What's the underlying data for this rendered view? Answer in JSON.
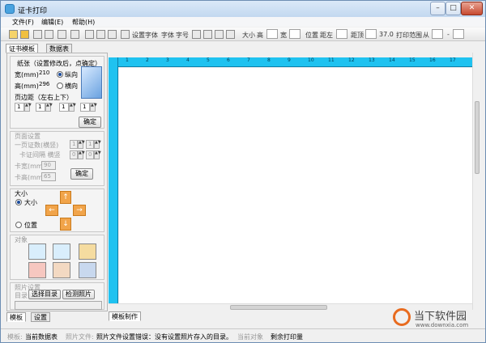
{
  "window": {
    "title": "证卡打印"
  },
  "menu": [
    "文件(F)",
    "编辑(E)",
    "帮助(H)"
  ],
  "toolbar": {
    "icons": [
      "new-icon",
      "open-icon",
      "save-icon",
      "save-as-icon",
      "print-icon",
      "preview-icon",
      "copy-icon",
      "paste-icon",
      "cut-icon",
      "text-icon"
    ],
    "labels": [
      "设置字体",
      "字体",
      "字号",
      "大小",
      "高",
      "宽",
      "位置",
      "距左",
      "距顶",
      "37.0",
      "打印范围",
      "从",
      "-"
    ]
  },
  "left_tabs": [
    "证书模板",
    "数据表"
  ],
  "paper": {
    "title": "纸张（设置修改后，点确定）",
    "width_label": "宽(mm)",
    "width_value": "210",
    "height_label": "高(mm)",
    "height_value": "296",
    "portrait": "纵向",
    "landscape": "横向",
    "margin_title": "页边距（左右上下）",
    "margins": [
      "1",
      "1",
      "1",
      "1"
    ],
    "ok": "确定"
  },
  "page_setup": {
    "title": "页面设置",
    "per_page": "一页证数(横竖)",
    "gap": "卡证间隔 横竖",
    "card_width_label": "卡宽(mm)",
    "card_width_value": "90",
    "card_height_label": "卡高(mm)",
    "card_height_value": "65",
    "spin_values": [
      "1",
      "1",
      "0",
      "0"
    ],
    "ok": "确定"
  },
  "size_group": {
    "title": "大小",
    "size_option": "大小",
    "position_option": "位置"
  },
  "objects": {
    "title": "对象"
  },
  "photo_setup": {
    "title": "照片设置",
    "dir_label": "目录",
    "select_dir": "选择目录",
    "check_photo": "检测照片"
  },
  "bottom_tabs": [
    "模板",
    "设置"
  ],
  "canvas_tab": "模板制作",
  "ruler": [
    "1",
    "2",
    "3",
    "4",
    "5",
    "6",
    "7",
    "8",
    "9",
    "10",
    "11",
    "12",
    "13",
    "14",
    "15",
    "16",
    "17"
  ],
  "status": {
    "template_label": "模板:",
    "template_value": "当前数据表",
    "photo_label": "照片文件:",
    "photo_value": "照片文件设置错误：没有设置照片存入的目录。",
    "current_object_label": "当前对象",
    "remaining_label": "剩余打印量"
  },
  "watermark": {
    "name": "当下软件园",
    "url": "www.downxia.com"
  },
  "colors": {
    "ruler": "#1fc2f0",
    "accent": "#e86b1f",
    "arrow": "#f1a44a"
  }
}
